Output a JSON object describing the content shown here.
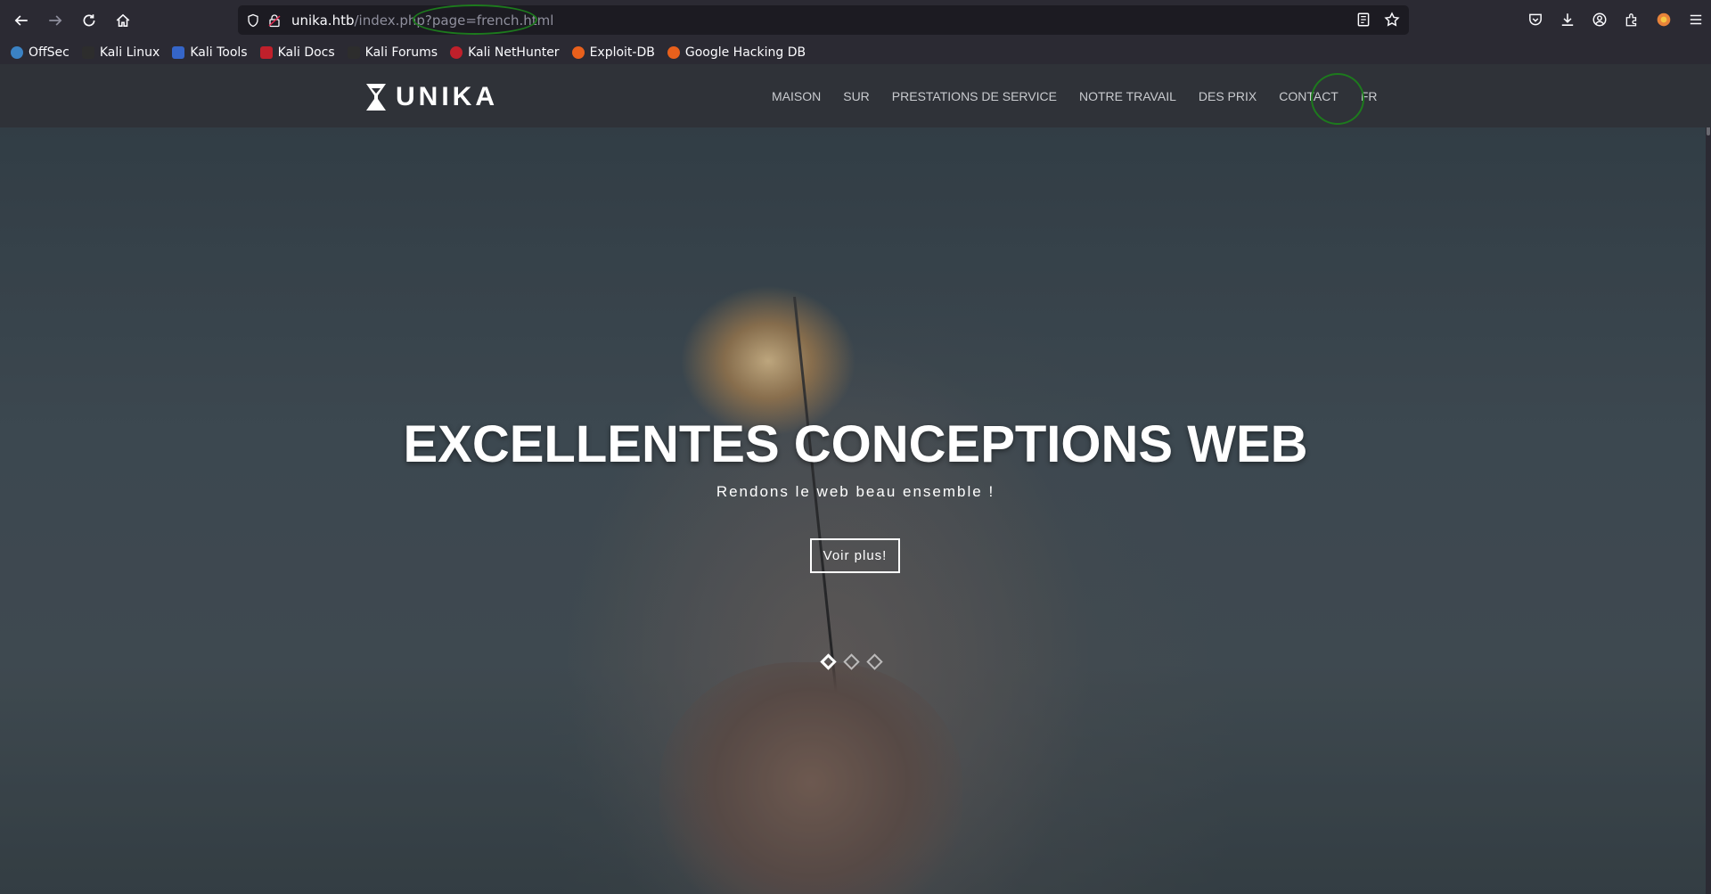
{
  "browser": {
    "url_host": "unika.htb",
    "url_path": "/index.php?page=french.html",
    "bookmarks": [
      {
        "label": "OffSec",
        "color": "#3b82c4"
      },
      {
        "label": "Kali Linux",
        "color": "#2d2d2d"
      },
      {
        "label": "Kali Tools",
        "color": "#3565c8"
      },
      {
        "label": "Kali Docs",
        "color": "#c0202b"
      },
      {
        "label": "Kali Forums",
        "color": "#2d2d2d"
      },
      {
        "label": "Kali NetHunter",
        "color": "#c0202b"
      },
      {
        "label": "Exploit-DB",
        "color": "#e8601c"
      },
      {
        "label": "Google Hacking DB",
        "color": "#e8601c"
      }
    ]
  },
  "site": {
    "logo": "UNIKA",
    "menu": [
      "MAISON",
      "SUR",
      "PRESTATIONS DE SERVICE",
      "NOTRE TRAVAIL",
      "DES PRIX",
      "CONTACT",
      "FR"
    ],
    "hero": {
      "title": "EXCELLENTES CONCEPTIONS WEB",
      "subtitle": "Rendons le web beau ensemble !",
      "button": "Voir plus!",
      "slides": 3,
      "active_slide": 1
    }
  },
  "colors": {
    "annotation_ring": "#1d7a1d",
    "nav_bg": "#2f3238"
  }
}
